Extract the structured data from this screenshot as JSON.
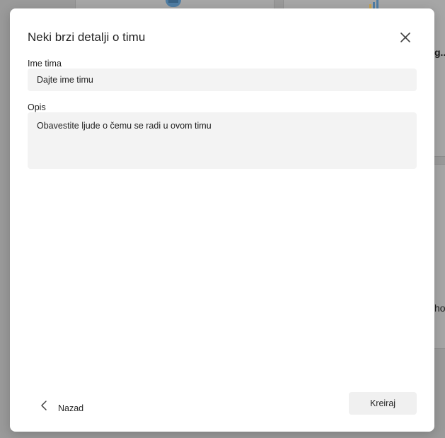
{
  "dialog": {
    "title": "Neki brzi detalji o timu",
    "close_icon": "close-icon"
  },
  "form": {
    "name_label": "Ime tima",
    "name_placeholder": "Dajte ime timu",
    "description_label": "Opis",
    "description_placeholder": "Obavestite ljude o čemu se radi u ovom timu"
  },
  "footer": {
    "back_label": "Nazad",
    "back_icon": "chevron-left-icon",
    "create_label": "Kreiraj"
  },
  "background": {
    "text_1": "g...",
    "text_2": "ho"
  },
  "colors": {
    "overlay": "#9a9a9a",
    "dialog_bg": "#ffffff",
    "input_bg": "#f3f3f3",
    "button_bg": "#f0f0f0",
    "text": "#242424"
  }
}
